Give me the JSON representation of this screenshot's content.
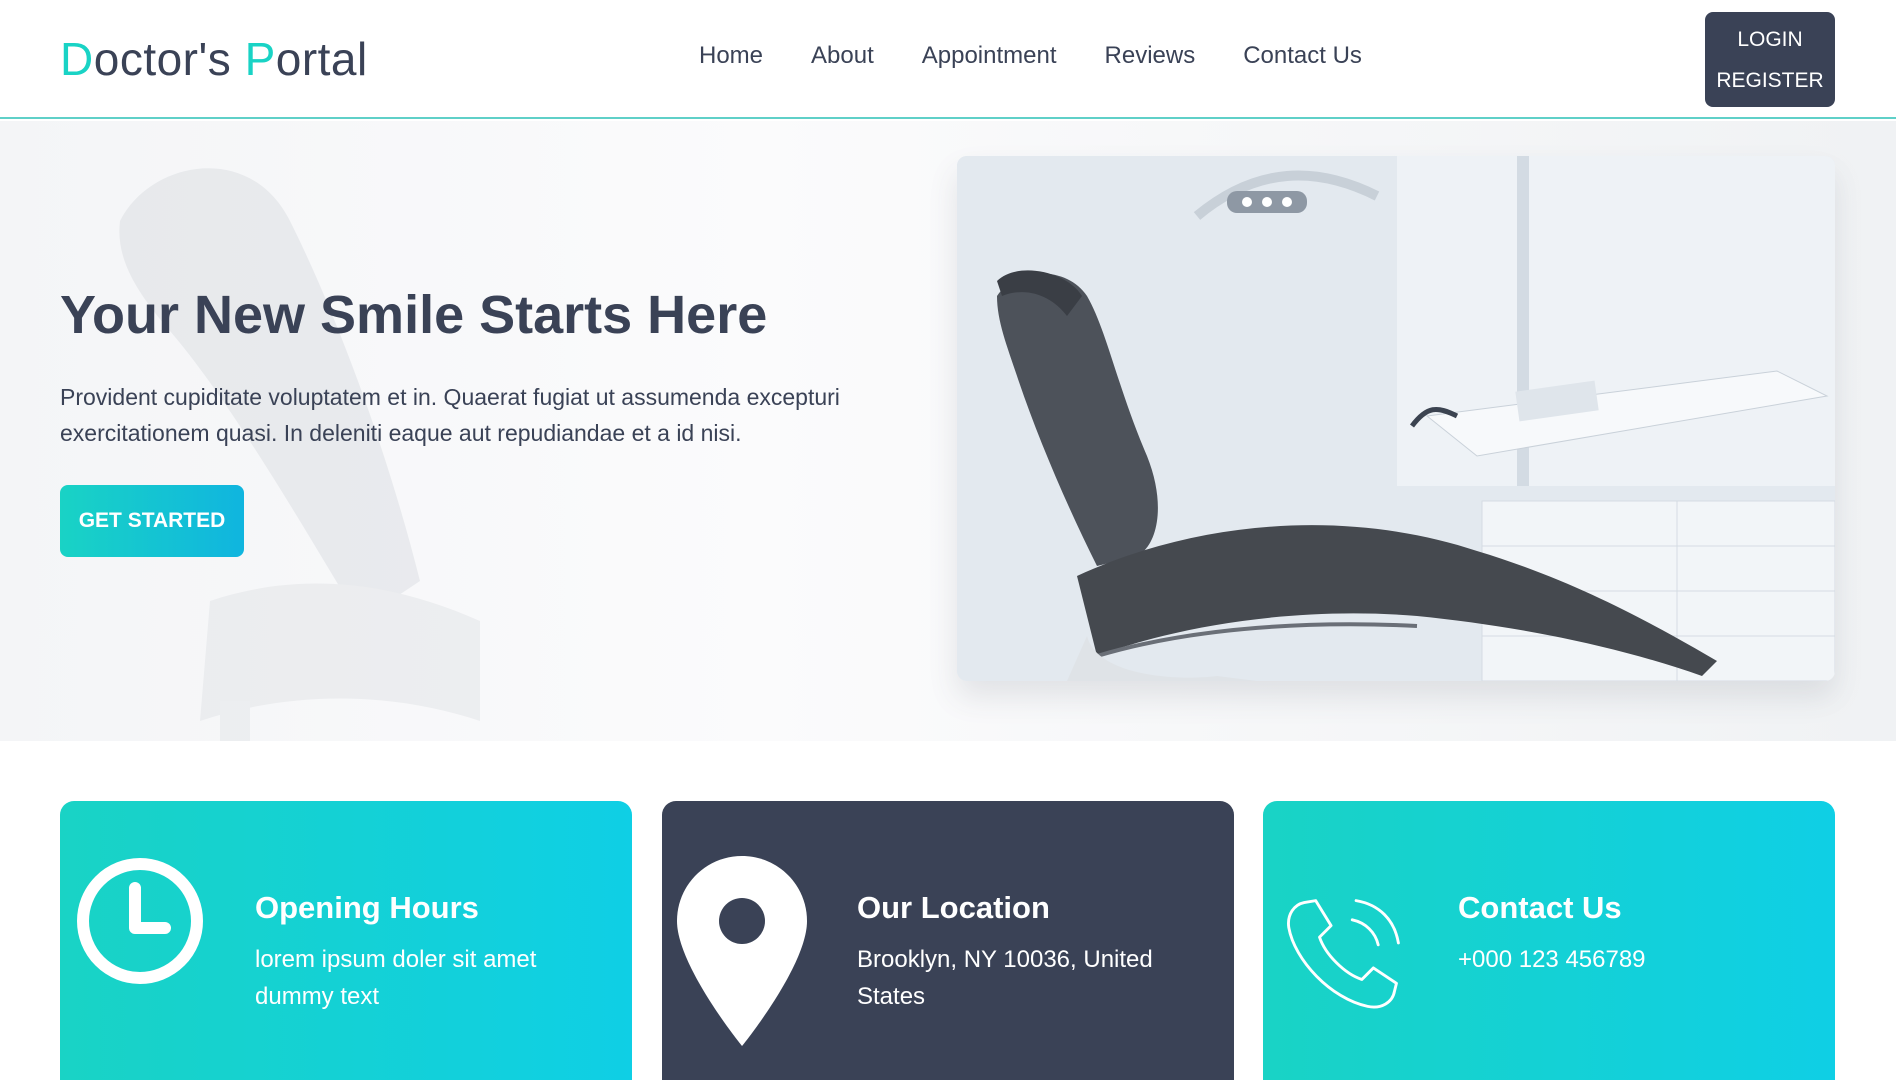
{
  "brand": {
    "first_letter": "D",
    "part1": "octor's ",
    "second_letter": "P",
    "part2": "ortal"
  },
  "nav": {
    "items": [
      {
        "label": "Home"
      },
      {
        "label": "About"
      },
      {
        "label": "Appointment"
      },
      {
        "label": "Reviews"
      },
      {
        "label": "Contact Us"
      }
    ],
    "login_label": "LOGIN",
    "register_label": "REGISTER"
  },
  "hero": {
    "title": "Your New Smile Starts Here",
    "text": "Provident cupiditate voluptatem et in. Quaerat fugiat ut assumenda excepturi exercitationem quasi. In deleniti eaque aut repudiandae et a id nisi.",
    "button_label": "GET STARTED"
  },
  "cards": [
    {
      "title": "Opening Hours",
      "text": "lorem ipsum doler sit amet dummy text",
      "icon": "clock-icon"
    },
    {
      "title": "Our Location",
      "text": "Brooklyn, NY 10036, United States",
      "icon": "location-pin-icon"
    },
    {
      "title": "Contact Us",
      "text": "+000 123 456789",
      "icon": "phone-icon"
    }
  ],
  "colors": {
    "primary_dark": "#3a4256",
    "accent_teal": "#19d3c5",
    "accent_cyan": "#0fcfe5",
    "nav_border": "#5fd0c8"
  }
}
